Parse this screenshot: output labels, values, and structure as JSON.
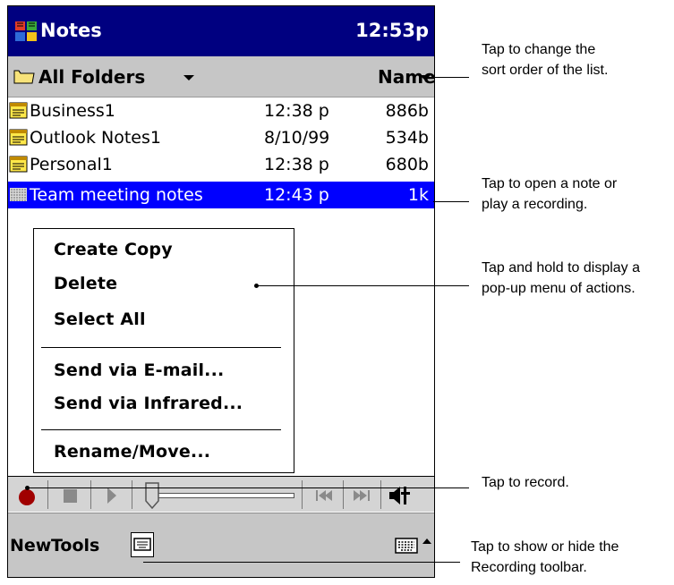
{
  "window": {
    "title": "Notes",
    "time": "12:53p"
  },
  "folder_bar": {
    "folder": "All Folders",
    "sort": "Name"
  },
  "notes": [
    {
      "name": "Business1",
      "date": "12:38 p",
      "size": "886b",
      "selected": false,
      "type": "note"
    },
    {
      "name": "Outlook Notes1",
      "date": "8/10/99",
      "size": "534b",
      "selected": false,
      "type": "note"
    },
    {
      "name": "Personal1",
      "date": "12:38 p",
      "size": "680b",
      "selected": false,
      "type": "note"
    },
    {
      "name": "Team meeting notes",
      "date": "12:43 p",
      "size": "1k",
      "selected": true,
      "type": "recording"
    }
  ],
  "context_menu": {
    "items": [
      "Create Copy",
      "Delete",
      "Select All",
      "Send via E-mail...",
      "Send via Infrared...",
      "Rename/Move..."
    ]
  },
  "recording_toolbar": {
    "buttons": [
      "record-icon",
      "stop-icon",
      "play-icon",
      "volume-slider",
      "skip-back-icon",
      "skip-forward-icon",
      "speaker-icon"
    ]
  },
  "command_bar": {
    "menus": [
      "New",
      "Tools"
    ],
    "icons": [
      "recording-toolbar-toggle-icon",
      "keyboard-icon",
      "input-caret-icon"
    ]
  },
  "callouts": {
    "sort": {
      "line1": "Tap to change the",
      "line2": "sort order of the list."
    },
    "open": {
      "line1": "Tap to open a note or",
      "line2": "play a recording."
    },
    "hold": {
      "line1": "Tap and hold to display a",
      "line2": "pop-up menu of actions."
    },
    "record": {
      "line1": "Tap to record."
    },
    "toolbar": {
      "line1": "Tap to show or hide the",
      "line2": "Recording toolbar."
    }
  },
  "colors": {
    "title_bar": "#000080",
    "selection": "#0000ff",
    "bar_gray": "#c6c6c6",
    "record_red": "#a00000"
  }
}
